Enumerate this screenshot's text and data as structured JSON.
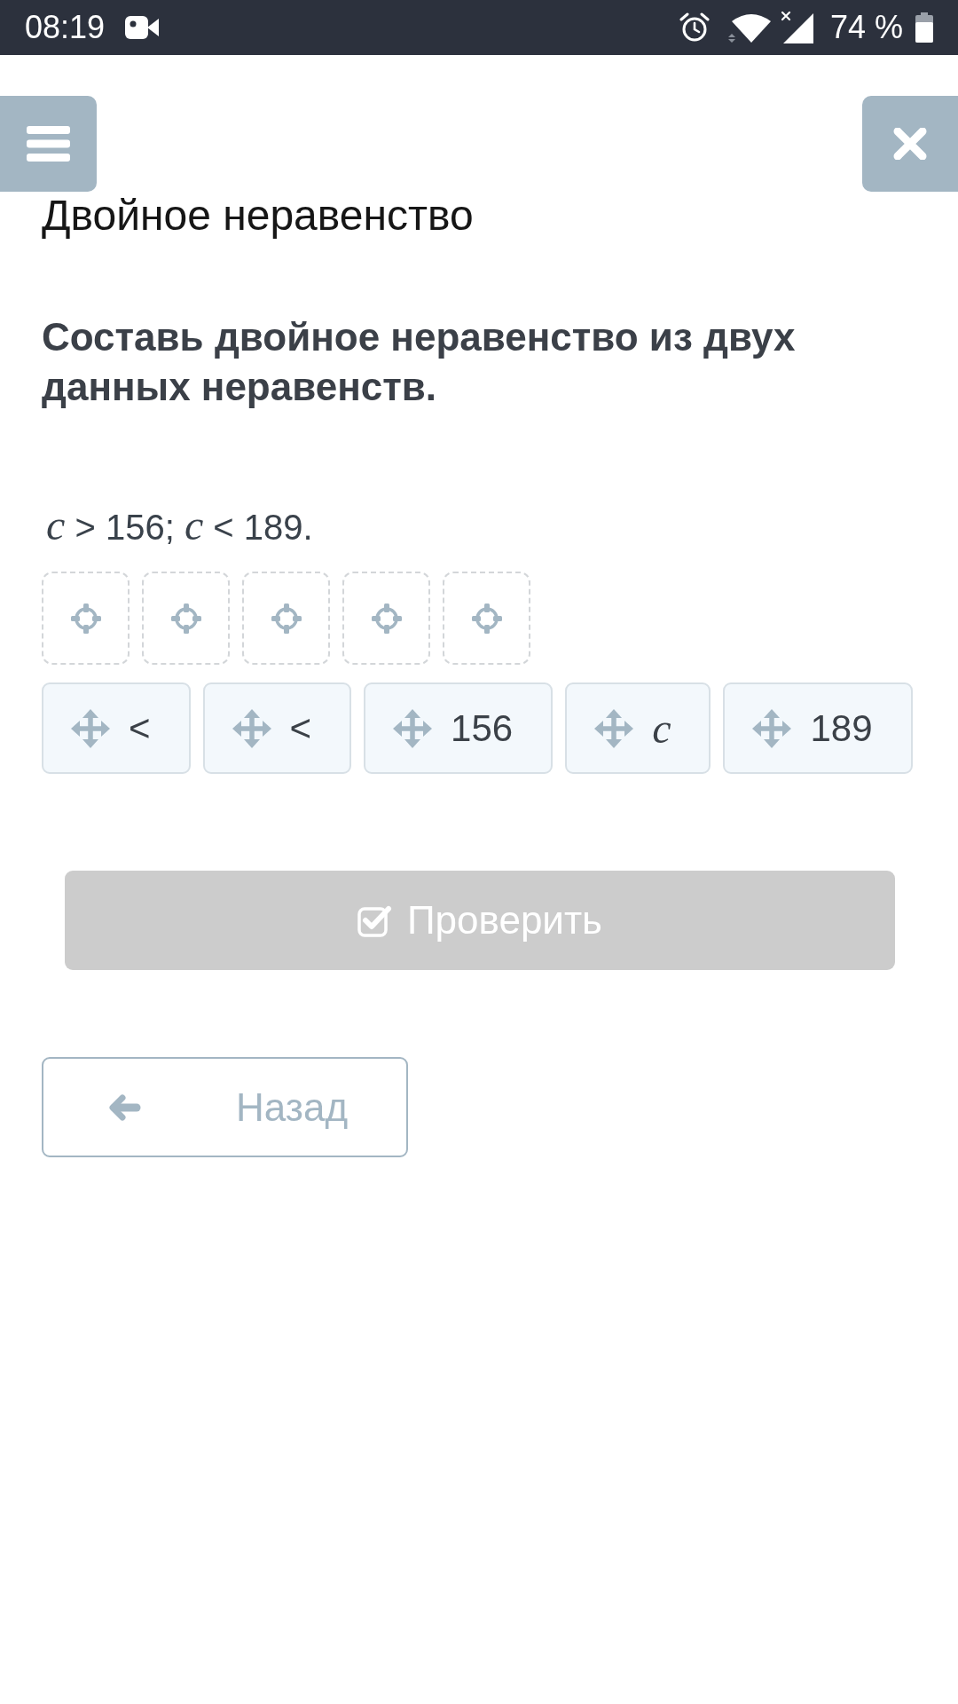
{
  "status_bar": {
    "time": "08:19",
    "battery": "74 %"
  },
  "title": "Двойное неравенство",
  "task": {
    "instruction": "Составь двойное неравенство из двух данных неравенств.",
    "expression": "*c* > 156; *c* < 189."
  },
  "answer_slots": [
    {
      "kind": "empty"
    },
    {
      "kind": "empty"
    },
    {
      "kind": "empty"
    },
    {
      "kind": "empty"
    },
    {
      "kind": "empty"
    }
  ],
  "tiles": [
    {
      "kind": "text",
      "label": "<"
    },
    {
      "kind": "text",
      "label": "<"
    },
    {
      "kind": "text",
      "label": "156"
    },
    {
      "kind": "variable",
      "label": "c"
    },
    {
      "kind": "text",
      "label": "189"
    }
  ],
  "check_button": {
    "label": "Проверить",
    "disabled": true
  },
  "back_button": {
    "label": "Назад"
  }
}
